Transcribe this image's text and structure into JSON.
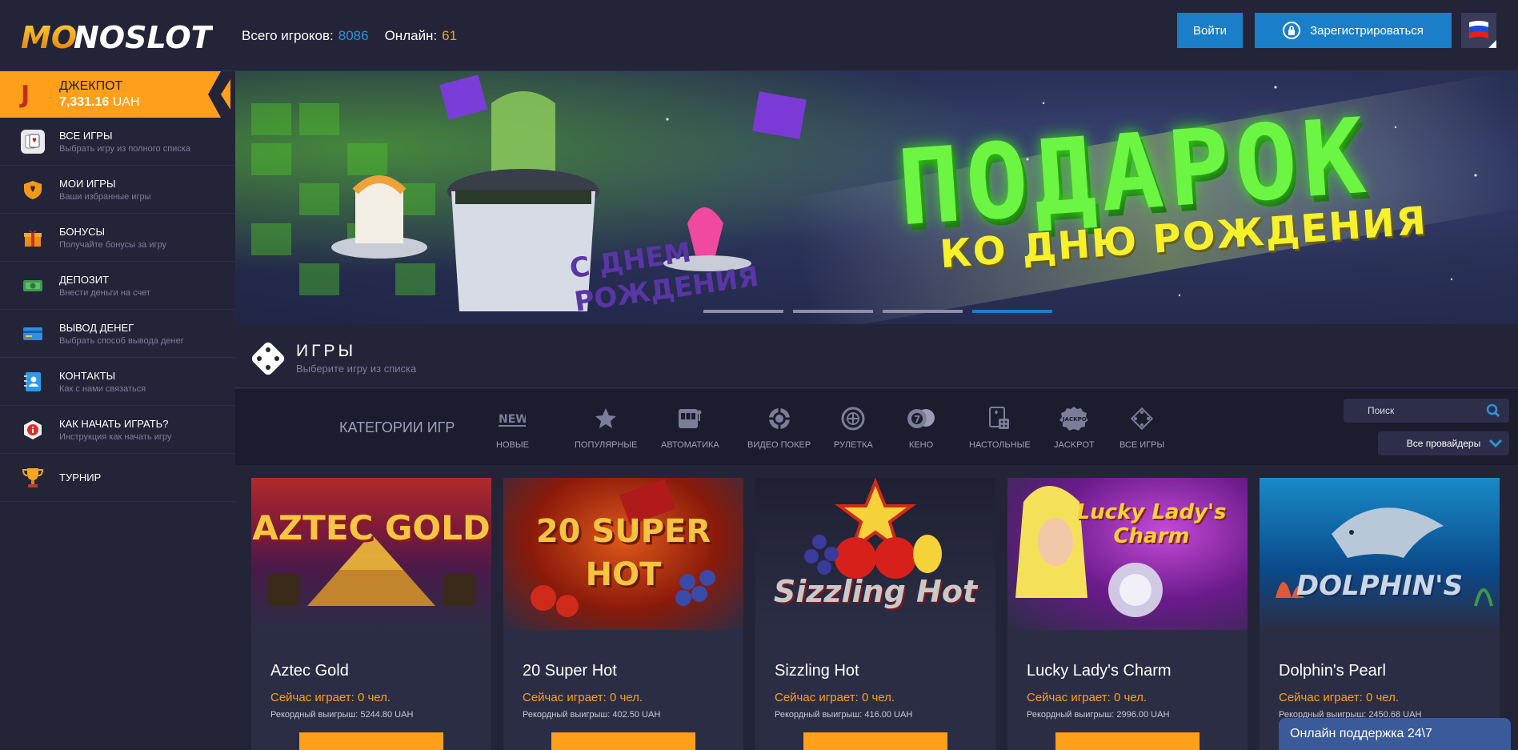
{
  "header": {
    "logo_text": "MONOSLOT",
    "total_players_label": "Всего игроков:",
    "total_players_value": "8086",
    "online_label": "Онлайн:",
    "online_value": "61",
    "login_label": "Войти",
    "register_label": "Зарегистрироваться",
    "language_icon": "russia-flag-icon"
  },
  "sidebar": {
    "jackpot": {
      "title": "ДЖЕКПОТ",
      "value": "7,331.16",
      "currency": "UAH"
    },
    "items": [
      {
        "label": "ВСЕ ИГРЫ",
        "sub": "Выбрать игру из полного списка",
        "icon": "cards-icon"
      },
      {
        "label": "МОИ ИГРЫ",
        "sub": "Ваши избранные игры",
        "icon": "heart-shield-icon"
      },
      {
        "label": "БОНУСЫ",
        "sub": "Получайте бонусы за игру",
        "icon": "gift-icon"
      },
      {
        "label": "ДЕПОЗИТ",
        "sub": "Внести деньги на счет",
        "icon": "money-icon"
      },
      {
        "label": "ВЫВОД ДЕНЕГ",
        "sub": "Выбрать способ вывода денег",
        "icon": "credit-card-icon"
      },
      {
        "label": "КОНТАКТЫ",
        "sub": "Как с нами связаться",
        "icon": "contact-book-icon"
      },
      {
        "label": "КАК НАЧАТЬ ИГРАТЬ?",
        "sub": "Инструкция как начать игру",
        "icon": "info-icon"
      },
      {
        "label": "ТУРНИР",
        "sub": "",
        "icon": "trophy-icon"
      }
    ]
  },
  "banner": {
    "title": "ПОДАРОК",
    "subtitle": "КО ДНЮ РОЖДЕНИЯ",
    "robot_text_line1": "С ДНЕМ",
    "robot_text_line2": "РОЖДЕНИЯ",
    "active_slide": 4,
    "slide_count": 4
  },
  "games_section": {
    "title": "ИГРЫ",
    "subtitle": "Выберите игру из списка"
  },
  "categories": {
    "label": "КАТЕГОРИИ ИГР",
    "items": [
      {
        "label": "НОВЫЕ",
        "icon": "new-icon"
      },
      {
        "label": "ПОПУЛЯРНЫЕ",
        "icon": "star-icon"
      },
      {
        "label": "АВТОМАТИКА",
        "icon": "slot-machine-icon"
      },
      {
        "label": "ВИДЕО ПОКЕР",
        "icon": "poker-chip-icon"
      },
      {
        "label": "РУЛЕТКА",
        "icon": "roulette-icon"
      },
      {
        "label": "КЕНО",
        "icon": "keno-balls-icon"
      },
      {
        "label": "НАСТОЛЬНЫЕ",
        "icon": "table-games-icon"
      },
      {
        "label": "JACKPOT",
        "icon": "jackpot-badge-icon"
      },
      {
        "label": "ВСЕ ИГРЫ",
        "icon": "all-games-icon"
      }
    ],
    "search_placeholder": "Поиск",
    "providers_label": "Все провайдеры"
  },
  "games": [
    {
      "name": "Aztec Gold",
      "playing": "Сейчас играет: 0 чел.",
      "record": "Рекордный выигрыш: 5244.80 UAH",
      "image_title": "AZTEC GOLD"
    },
    {
      "name": "20 Super Hot",
      "playing": "Сейчас играет: 0 чел.",
      "record": "Рекордный выигрыш: 402.50 UAH",
      "image_title": "20 SUPER HOT"
    },
    {
      "name": "Sizzling Hot",
      "playing": "Сейчас играет: 0 чел.",
      "record": "Рекордный выигрыш: 416.00 UAH",
      "image_title": "Sizzling Hot"
    },
    {
      "name": "Lucky Lady's Charm",
      "playing": "Сейчас играет: 0 чел.",
      "record": "Рекордный выигрыш: 2996.00 UAH",
      "image_title": "Lucky Lady's Charm"
    },
    {
      "name": "Dolphin's Pearl",
      "playing": "Сейчас играет: 0 чел.",
      "record": "Рекордный выигрыш: 2450.68 UAH",
      "image_title": "DOLPHIN'S"
    }
  ],
  "support": {
    "label": "Онлайн поддержка 24\\7"
  }
}
